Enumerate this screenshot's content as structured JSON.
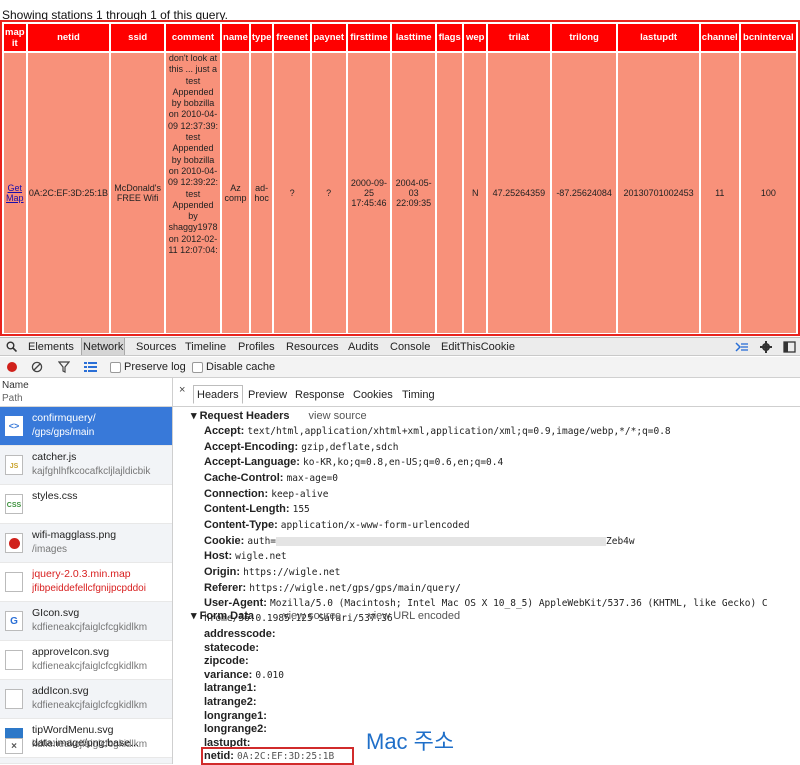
{
  "page": {
    "summary": "Showing stations 1 through 1 of this query."
  },
  "stations_table": {
    "headers": [
      "map it",
      "netid",
      "ssid",
      "comment",
      "name",
      "type",
      "freenet",
      "paynet",
      "firsttime",
      "lasttime",
      "flags",
      "wep",
      "trilat",
      "trilong",
      "lastupdt",
      "channel",
      "bcninterval"
    ],
    "row": {
      "map_link": "Get Map",
      "netid": "0A:2C:EF:3D:25:1B",
      "ssid": "McDonald's FREE Wifi",
      "comment": "don't look at this ... just a test Appended by bobzilla on 2010-04-09 12:37:39: test Appended by bobzilla on 2010-04-09 12:39:22: test Appended by shaggy1978 on 2012-02-11 12:07:04:",
      "name": "Az comp",
      "type": "ad-hoc",
      "freenet": "?",
      "paynet": "?",
      "firsttime": "2000-09-25 17:45:46",
      "lasttime": "2004-05-03 22:09:35",
      "flags": "",
      "wep": "N",
      "trilat": "47.25264359",
      "trilong": "-87.25624084",
      "lastupdt": "20130701002453",
      "channel": "11",
      "bcninterval": "100"
    }
  },
  "devtools": {
    "tabs": [
      "Elements",
      "Network",
      "Sources",
      "Timeline",
      "Profiles",
      "Resources",
      "Audits",
      "Console",
      "EditThisCookie"
    ],
    "selected_tab": "Network",
    "preserve_log": "Preserve log",
    "disable_cache": "Disable cache",
    "list_header": {
      "name": "Name",
      "path": "Path"
    },
    "files": [
      {
        "name": "confirmquery/",
        "path": "/gps/gps/main",
        "icon": "document-icon"
      },
      {
        "name": "catcher.js",
        "path": "kajfghlhfkcocafkcljlajldicbik",
        "icon": "js-file-icon"
      },
      {
        "name": "styles.css",
        "path": "",
        "icon": "css-file-icon"
      },
      {
        "name": "wifi-magglass.png",
        "path": "/images",
        "icon": "image-icon"
      },
      {
        "name": "jquery-2.0.3.min.map",
        "path": "jfibpeiddefellcfgnijpcpddoi",
        "icon": "blank-file-icon"
      },
      {
        "name": "GIcon.svg",
        "path": "kdfieneakcjfaiglcfcgkidlkm",
        "icon": "g-icon"
      },
      {
        "name": "approveIcon.svg",
        "path": "kdfieneakcjfaiglcfcgkidlkm",
        "icon": "blank-file-icon"
      },
      {
        "name": "addIcon.svg",
        "path": "kdfieneakcjfaiglcfcgkidlkm",
        "icon": "blank-file-icon"
      },
      {
        "name": "tipWordMenu.svg",
        "path": "kdfieneakcjfaiglcfcgkidlkm",
        "icon": "image-icon"
      },
      {
        "name": "data:image/png;base...",
        "path": "",
        "icon": "close-icon"
      }
    ],
    "detail_tabs": [
      "Headers",
      "Preview",
      "Response",
      "Cookies",
      "Timing"
    ],
    "request_headers_title": "Request Headers",
    "view_source": "view source",
    "view_url_encoded": "view URL encoded",
    "headers": [
      {
        "k": "Accept:",
        "v": "text/html,application/xhtml+xml,application/xml;q=0.9,image/webp,*/*;q=0.8"
      },
      {
        "k": "Accept-Encoding:",
        "v": "gzip,deflate,sdch"
      },
      {
        "k": "Accept-Language:",
        "v": "ko-KR,ko;q=0.8,en-US;q=0.6,en;q=0.4"
      },
      {
        "k": "Cache-Control:",
        "v": "max-age=0"
      },
      {
        "k": "Connection:",
        "v": "keep-alive"
      },
      {
        "k": "Content-Length:",
        "v": "155"
      },
      {
        "k": "Content-Type:",
        "v": "application/x-www-form-urlencoded"
      },
      {
        "k": "Cookie:",
        "v": "auth=",
        "v_tail": "Zeb4w"
      },
      {
        "k": "Host:",
        "v": "wigle.net"
      },
      {
        "k": "Origin:",
        "v": "https://wigle.net"
      },
      {
        "k": "Referer:",
        "v": "https://wigle.net/gps/gps/main/query/"
      },
      {
        "k": "User-Agent:",
        "v": "Mozilla/5.0 (Macintosh; Intel Mac OS X 10_8_5) AppleWebKit/537.36 (KHTML, like Gecko) C"
      },
      {
        "k": "",
        "v": "hrome/36.0.1985.125 Safari/537.36"
      }
    ],
    "form_data_title": "Form Data",
    "form_data": [
      {
        "k": "addresscode:",
        "v": ""
      },
      {
        "k": "statecode:",
        "v": ""
      },
      {
        "k": "zipcode:",
        "v": ""
      },
      {
        "k": "variance:",
        "v": "0.010"
      },
      {
        "k": "latrange1:",
        "v": ""
      },
      {
        "k": "latrange2:",
        "v": ""
      },
      {
        "k": "longrange1:",
        "v": ""
      },
      {
        "k": "longrange2:",
        "v": ""
      },
      {
        "k": "lastupdt:",
        "v": ""
      },
      {
        "k": "netid:",
        "v": "0A:2C:EF:3D:25:1B"
      }
    ]
  },
  "annotation": "Mac 주소",
  "colors": {
    "header_red": "#ff0000",
    "cell_salmon": "#f8917a",
    "annotation_blue": "#1f6fc9",
    "selected_blue": "#3879d9"
  }
}
